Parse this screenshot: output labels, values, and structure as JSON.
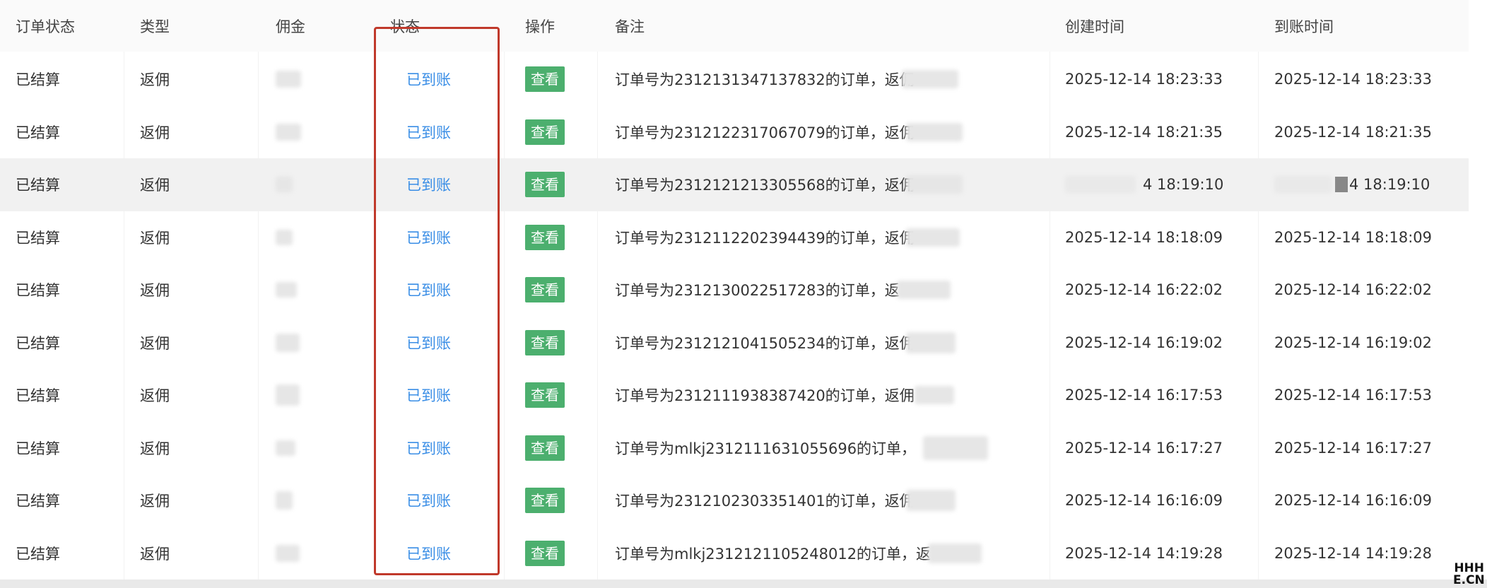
{
  "headers": [
    "订单状态",
    "类型",
    "佣金",
    "状态",
    "操作",
    "备注",
    "创建时间",
    "到账时间"
  ],
  "rows": [
    {
      "order_status": "已结算",
      "type": "返佣",
      "state": "已到账",
      "action": "查看",
      "remark": "订单号为2312131347137832的订单，返佣",
      "created": "2025-12-14 18:23:33",
      "arrived": "2025-12-14 18:23:33"
    },
    {
      "order_status": "已结算",
      "type": "返佣",
      "state": "已到账",
      "action": "查看",
      "remark": "订单号为2312122317067079的订单，返佣",
      "created": "2025-12-14 18:21:35",
      "arrived": "2025-12-14 18:21:35"
    },
    {
      "order_status": "已结算",
      "type": "返佣",
      "state": "已到账",
      "action": "查看",
      "remark": "订单号为2312121213305568的订单，返佣",
      "created": "4 18:19:10",
      "arrived": "4 18:19:10"
    },
    {
      "order_status": "已结算",
      "type": "返佣",
      "state": "已到账",
      "action": "查看",
      "remark": "订单号为2312112202394439的订单，返佣",
      "created": "2025-12-14 18:18:09",
      "arrived": "2025-12-14 18:18:09"
    },
    {
      "order_status": "已结算",
      "type": "返佣",
      "state": "已到账",
      "action": "查看",
      "remark": "订单号为2312130022517283的订单，返",
      "created": "2025-12-14 16:22:02",
      "arrived": "2025-12-14 16:22:02"
    },
    {
      "order_status": "已结算",
      "type": "返佣",
      "state": "已到账",
      "action": "查看",
      "remark": "订单号为2312121041505234的订单，返佣",
      "created": "2025-12-14 16:19:02",
      "arrived": "2025-12-14 16:19:02"
    },
    {
      "order_status": "已结算",
      "type": "返佣",
      "state": "已到账",
      "action": "查看",
      "remark": "订单号为2312111938387420的订单，返佣",
      "created": "2025-12-14 16:17:53",
      "arrived": "2025-12-14 16:17:53"
    },
    {
      "order_status": "已结算",
      "type": "返佣",
      "state": "已到账",
      "action": "查看",
      "remark": "订单号为mlkj2312111631055696的订单，",
      "created": "2025-12-14 16:17:27",
      "arrived": "2025-12-14 16:17:27"
    },
    {
      "order_status": "已结算",
      "type": "返佣",
      "state": "已到账",
      "action": "查看",
      "remark": "订单号为2312102303351401的订单，返佣",
      "created": "2025-12-14 16:16:09",
      "arrived": "2025-12-14 16:16:09"
    },
    {
      "order_status": "已结算",
      "type": "返佣",
      "state": "已到账",
      "action": "查看",
      "remark": "订单号为mlkj2312121105248012的订单，返",
      "created": "2025-12-14 14:19:28",
      "arrived": "2025-12-14 14:19:28"
    }
  ],
  "watermark": {
    "line1": "HHH",
    "line2": "E.CN"
  },
  "colors": {
    "link": "#3a8ee6",
    "button": "#4caf6e",
    "highlight_box": "#c0392b"
  }
}
